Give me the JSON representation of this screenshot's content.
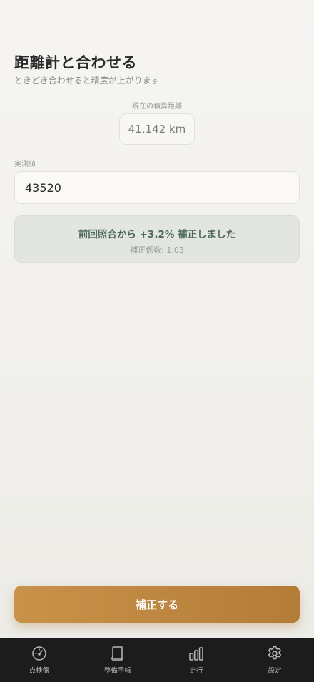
{
  "header": {
    "title": "距離計と合わせる",
    "subtitle": "ときどき合わせると精度が上がります"
  },
  "odometer": {
    "label": "現在の積算距離",
    "value": "41,142 km"
  },
  "actual": {
    "label": "実測値",
    "value": "43520"
  },
  "result": {
    "message": "前回照合から +3.2% 補正しました",
    "coefficient": "補正係数: 1.03"
  },
  "primary_button": {
    "label": "補正する"
  },
  "colors": {
    "accent": "#c8924a",
    "result_text": "#4e6b5f",
    "tabbar_bg": "#1c1c1c"
  },
  "tabbar": {
    "items": [
      {
        "label": "点検盤",
        "icon": "gauge-icon"
      },
      {
        "label": "整備手帳",
        "icon": "book-icon"
      },
      {
        "label": "走行",
        "icon": "bar-chart-icon"
      },
      {
        "label": "設定",
        "icon": "gear-icon"
      }
    ]
  }
}
